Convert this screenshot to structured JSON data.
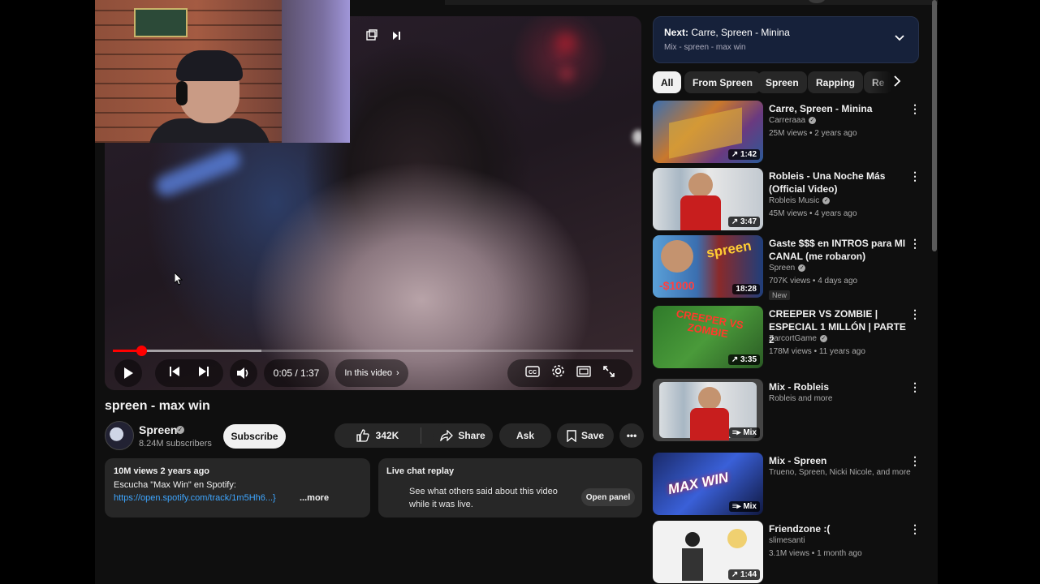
{
  "player": {
    "time": "0:05 / 1:37",
    "chapter_label": "In this video",
    "progress_fraction": 0.054,
    "buffer_fraction": 0.286
  },
  "video": {
    "title": "spreen - max win",
    "channel": "Spreen",
    "subscribers": "8.24M subscribers",
    "subscribe_label": "Subscribe",
    "likes": "342K",
    "share_label": "Share",
    "ask_label": "Ask",
    "save_label": "Save"
  },
  "description": {
    "meta": "10M views  2 years ago",
    "line1": "Escucha \"Max Win\" en Spotify:",
    "link": "https://open.spotify.com/track/1m5Hh6...}",
    "more": "...more"
  },
  "chat": {
    "title": "Live chat replay",
    "text": "See what others said about this video while it was live.",
    "button": "Open panel"
  },
  "next": {
    "label": "Next:",
    "title": "Carre, Spreen - Minina",
    "sub": "Mix - spreen - max win"
  },
  "chips": [
    "All",
    "From Spreen",
    "Spreen",
    "Rapping",
    "Re"
  ],
  "recommendations": [
    {
      "title": "Carre, Spreen - Minina",
      "channel": "Carreraaa",
      "verified": true,
      "meta": "25M views • 2 years ago",
      "badge": "1:42"
    },
    {
      "title": "Robleis - Una Noche Más (Official Video)",
      "channel": "Robleis Music",
      "verified": true,
      "meta": "45M views • 4 years ago",
      "badge": "3:47"
    },
    {
      "title": "Gaste $$$ en INTROS para MI CANAL (me robaron)",
      "channel": "Spreen",
      "verified": true,
      "meta": "707K views • 4 days ago",
      "badge": "18:28",
      "new": "New",
      "thumb_text": "spreen",
      "thumb_price": "-$1000"
    },
    {
      "title": "CREEPER VS ZOMBIE | ESPECIAL 1 MILLÓN | PARTE 2",
      "channel": "ZarcortGame",
      "verified": true,
      "meta": "178M views • 11 years ago",
      "badge": "3:35",
      "thumb_text": "CREEPER VS ZOMBIE"
    },
    {
      "title": "Mix - Robleis",
      "channel": "Robleis and more",
      "verified": false,
      "meta": "",
      "badge": "Mix"
    },
    {
      "title": "Mix - Spreen",
      "channel": "Trueno, Spreen, Nicki Nicole, and more",
      "verified": false,
      "meta": "",
      "badge": "Mix",
      "thumb_text": "MAX WIN"
    },
    {
      "title": "Friendzone :(",
      "channel": "slimesanti",
      "verified": false,
      "meta": "3.1M views • 1 month ago",
      "badge": "1:44"
    }
  ],
  "colors": {
    "accent_red": "#ff0000",
    "link_blue": "#3ea6ff",
    "next_panel": "#16213a"
  }
}
